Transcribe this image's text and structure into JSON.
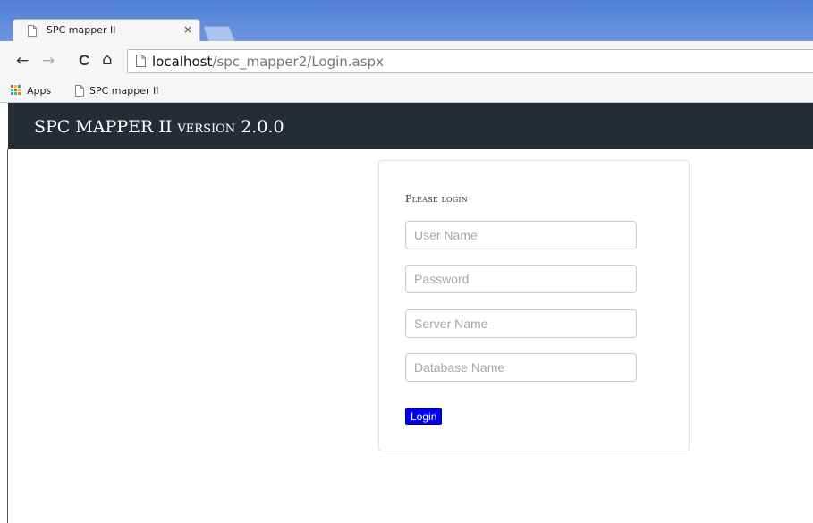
{
  "browser": {
    "tab": {
      "title": "SPC mapper II",
      "close_glyph": "×"
    },
    "nav": {
      "back_icon": "←",
      "forward_icon": "→",
      "reload_icon": "C",
      "home_icon": "⌂"
    },
    "address": {
      "host": "localhost",
      "path": "/spc_mapper2/Login.aspx"
    },
    "bookmarks": [
      {
        "label": "Apps",
        "icon": "apps-grid-icon"
      },
      {
        "label": "SPC mapper II",
        "icon": "page-icon"
      }
    ]
  },
  "header": {
    "app_name": "SPC MAPPER II",
    "version_label": "version",
    "version_number": "2.0.0"
  },
  "login": {
    "heading": "Please login",
    "fields": [
      {
        "placeholder": "User Name",
        "value": ""
      },
      {
        "placeholder": "Password",
        "value": ""
      },
      {
        "placeholder": "Server Name",
        "value": ""
      },
      {
        "placeholder": "Database Name",
        "value": ""
      }
    ],
    "button_label": "Login"
  },
  "colors": {
    "titlebar": "#5b89d8",
    "header_bg": "#262c33",
    "button_bg": "#0000ee"
  }
}
